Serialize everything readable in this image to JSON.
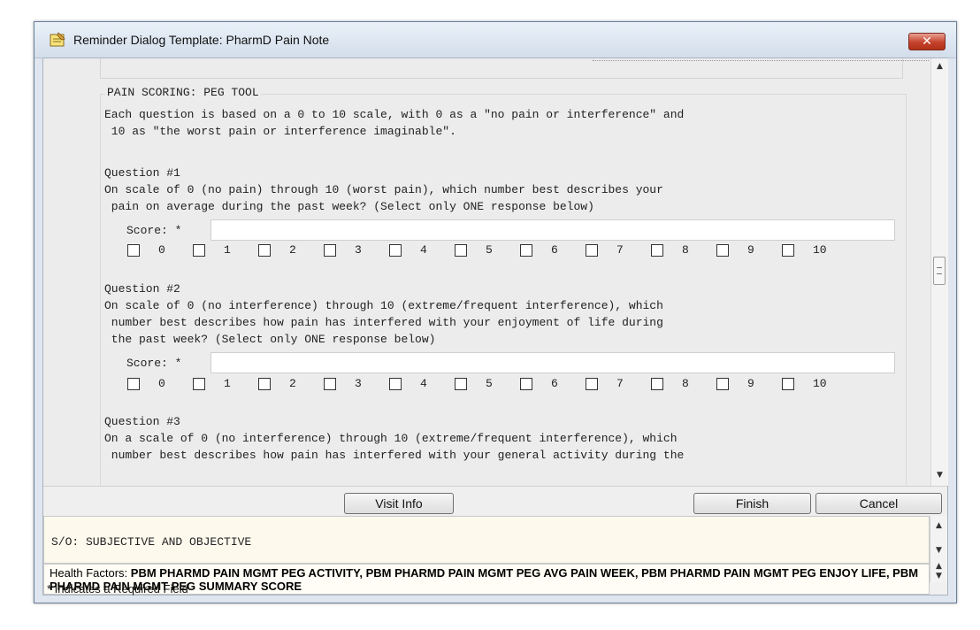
{
  "window": {
    "title": "Reminder Dialog Template: PharmD Pain Note",
    "close_glyph": "✕"
  },
  "group": {
    "caption": "PAIN SCORING: PEG TOOL"
  },
  "intro": [
    "Each question is based on a 0 to 10 scale, with 0 as a \"no pain or interference\" and",
    " 10 as \"the worst pain or interference imaginable\"."
  ],
  "questions": [
    {
      "heading": "Question #1",
      "lines": [
        "On scale of 0 (no pain) through 10 (worst pain), which number best describes your",
        " pain on average during the past week? (Select only ONE response below)"
      ],
      "score_label": "Score: *",
      "score_value": ""
    },
    {
      "heading": "Question #2",
      "lines": [
        "On scale of 0 (no interference) through 10 (extreme/frequent interference), which",
        " number best describes how pain has interfered with your enjoyment of life during",
        " the past week? (Select only ONE response below)"
      ],
      "score_label": "Score: *",
      "score_value": ""
    },
    {
      "heading": "Question #3",
      "lines": [
        "On a scale of 0 (no interference) through 10 (extreme/frequent interference), which",
        " number best describes how pain has interfered with your general activity during the"
      ]
    }
  ],
  "options": [
    "0",
    "1",
    "2",
    "3",
    "4",
    "5",
    "6",
    "7",
    "8",
    "9",
    "10"
  ],
  "buttons": {
    "visit_info": "Visit Info",
    "finish": "Finish",
    "cancel": "Cancel"
  },
  "so_text": "S/O: SUBJECTIVE AND OBJECTIVE",
  "health_factors": {
    "label": "Health Factors:",
    "value": "PBM PHARMD PAIN MGMT PEG ACTIVITY, PBM PHARMD PAIN MGMT PEG AVG PAIN WEEK, PBM PHARMD PAIN MGMT PEG ENJOY LIFE, PBM PHARMD PAIN MGMT PEG SUMMARY SCORE"
  },
  "status": "* Indicates a Required Field",
  "icons": {
    "scroll_up": "▲",
    "scroll_down": "▼",
    "title_icon": "notepad-icon"
  }
}
